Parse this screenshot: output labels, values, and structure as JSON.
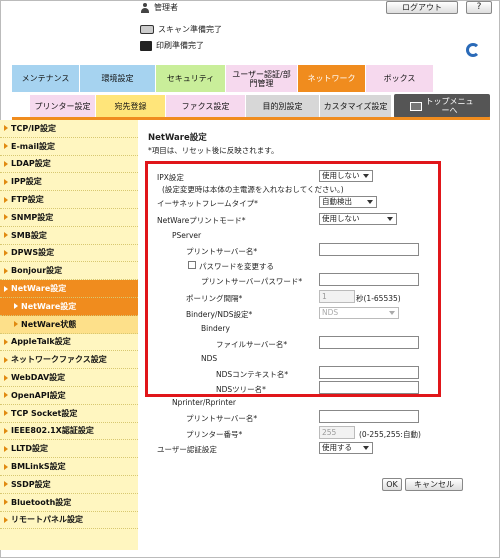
{
  "header": {
    "user_label": "管理者",
    "logout_label": "ログアウト",
    "help_label": "?",
    "scan_status": "スキャン準備完了",
    "print_status": "印刷準備完了"
  },
  "main_tabs": [
    {
      "label": "メンテナンス",
      "color": "#a6d3f0"
    },
    {
      "label": "環境設定",
      "color": "#a6d3f0"
    },
    {
      "label": "セキュリティ",
      "color": "#c9ee9a"
    },
    {
      "label": "ユーザー認証/部門管理",
      "color": "#f6d9ee"
    },
    {
      "label": "ネットワーク",
      "color": "#f08c1e"
    },
    {
      "label": "ボックス",
      "color": "#f6d9ee"
    }
  ],
  "sub_tabs": [
    {
      "label": "プリンター設定",
      "color": "#f6d9ee"
    },
    {
      "label": "宛先登録",
      "color": "#ffe57a"
    },
    {
      "label": "ファクス設定",
      "color": "#f6d9ee"
    },
    {
      "label": "目的別設定",
      "color": "#d7d7d7"
    },
    {
      "label": "カスタマイズ設定",
      "color": "#d7d7d7"
    }
  ],
  "top_menu_label": "トップメニューへ",
  "sidebar": {
    "items": [
      {
        "label": "TCP/IP設定"
      },
      {
        "label": "E-mail設定"
      },
      {
        "label": "LDAP設定"
      },
      {
        "label": "IPP設定"
      },
      {
        "label": "FTP設定"
      },
      {
        "label": "SNMP設定"
      },
      {
        "label": "SMB設定"
      },
      {
        "label": "DPWS設定"
      },
      {
        "label": "Bonjour設定"
      },
      {
        "label": "NetWare設定"
      },
      {
        "label": "NetWare設定"
      },
      {
        "label": "NetWare状態"
      },
      {
        "label": "AppleTalk設定"
      },
      {
        "label": "ネットワークファクス設定"
      },
      {
        "label": "WebDAV設定"
      },
      {
        "label": "OpenAPI設定"
      },
      {
        "label": "TCP Socket設定"
      },
      {
        "label": "IEEE802.1X認証設定"
      },
      {
        "label": "LLTD設定"
      },
      {
        "label": "BMLinkS設定"
      },
      {
        "label": "SSDP設定"
      },
      {
        "label": "Bluetooth設定"
      },
      {
        "label": "リモートパネル設定"
      }
    ]
  },
  "content": {
    "title": "NetWare設定",
    "note": "*項目は、リセット後に反映されます。",
    "ipx_label": "IPX設定",
    "ipx_value": "使用しない",
    "ipx_note": "(設定変更時は本体の主電源を入れなおしてください。)",
    "frame_label": "イーサネットフレームタイプ*",
    "frame_value": "自動検出",
    "print_mode_label": "NetWareプリントモード*",
    "print_mode_value": "使用しない",
    "pserver_label": "PServer",
    "print_server_name_label": "プリントサーバー名*",
    "change_password_label": "パスワードを変更する",
    "print_server_password_label": "プリントサーバーパスワード*",
    "polling_label": "ポーリング間隔*",
    "polling_value": "1",
    "polling_unit": "秒(1-65535)",
    "bindery_nds_label": "Bindery/NDS設定*",
    "bindery_nds_value": "NDS",
    "bindery_label": "Bindery",
    "file_server_label": "ファイルサーバー名*",
    "nds_label": "NDS",
    "nds_context_label": "NDSコンテキスト名*",
    "nds_tree_label": "NDSツリー名*",
    "nprinter_label": "Nprinter/Rprinter",
    "np_server_name_label": "プリントサーバー名*",
    "printer_number_label": "プリンター番号*",
    "printer_number_value": "255",
    "printer_number_range": "(0-255,255:自動)",
    "user_auth_label": "ユーザー認証設定",
    "user_auth_value": "使用する",
    "ok_label": "OK",
    "cancel_label": "キャンセル"
  },
  "colors": {
    "accent": "#f08c1e",
    "sidebar_bg": "#fff6c0",
    "highlight_box": "#e0161a"
  }
}
